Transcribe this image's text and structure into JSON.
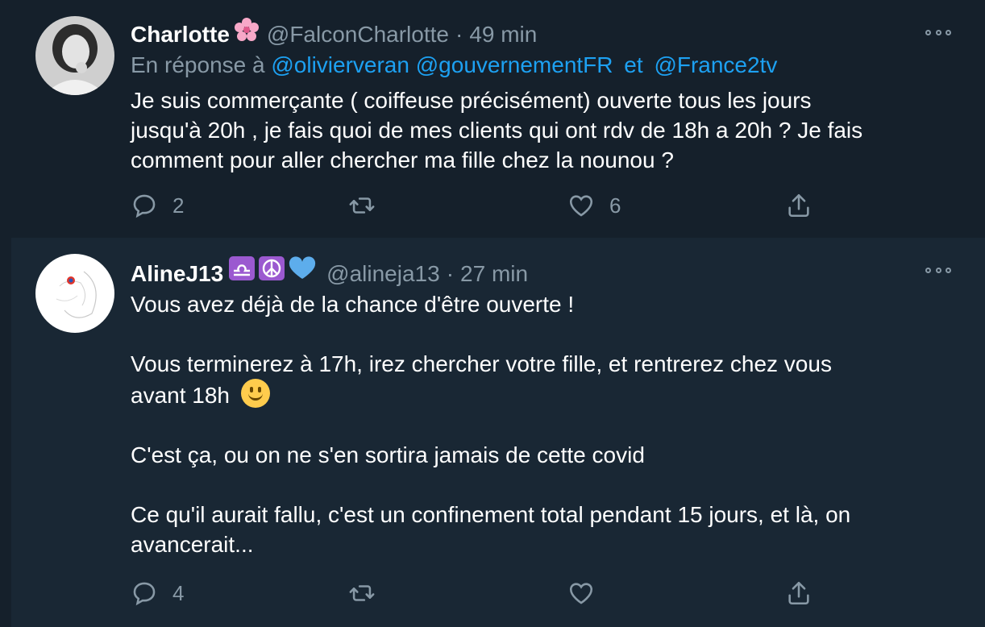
{
  "tweets": [
    {
      "name": "Charlotte",
      "name_emoji": "🌸",
      "handle": "@FalconCharlotte",
      "separator": "·",
      "time": "49 min",
      "reply_prefix": "En réponse à",
      "mentions": [
        "@olivierveran",
        "@gouvernementFR",
        "@France2tv"
      ],
      "reply_joiner": "et",
      "body": [
        "Je suis commerçante ( coiffeuse précisément) ouverte tous les jours",
        "jusqu'à 20h , je fais quoi de mes clients qui ont rdv de 18h a 20h ? Je fais",
        "comment pour aller chercher ma fille chez la nounou ?"
      ],
      "stats": {
        "replies": "2",
        "retweets": "",
        "likes": "6"
      }
    },
    {
      "name": "AlineJ13",
      "name_emoji": "♎☮️💙",
      "handle": "@alineja13",
      "separator": "·",
      "time": "27 min",
      "body": [
        "Vous avez déjà de la chance d'être ouverte !",
        "Vous terminerez à 17h, irez chercher votre fille, et rentrerez chez vous",
        "avant 18h",
        "C'est ça, ou on ne s'en sortira jamais de cette covid",
        "Ce qu'il aurait fallu, c'est un confinement total pendant 15 jours, et là, on",
        "avancerait..."
      ],
      "stats": {
        "replies": "4",
        "retweets": "",
        "likes": ""
      }
    }
  ],
  "icons": {
    "reply": "reply-icon",
    "retweet": "retweet-icon",
    "like": "heart-icon",
    "share": "share-icon",
    "more": "more-icon"
  },
  "colors": {
    "background": "#15202b",
    "reply_background": "#192734",
    "text": "#ffffff",
    "secondary": "#8899a6",
    "accent": "#1da1f2"
  }
}
